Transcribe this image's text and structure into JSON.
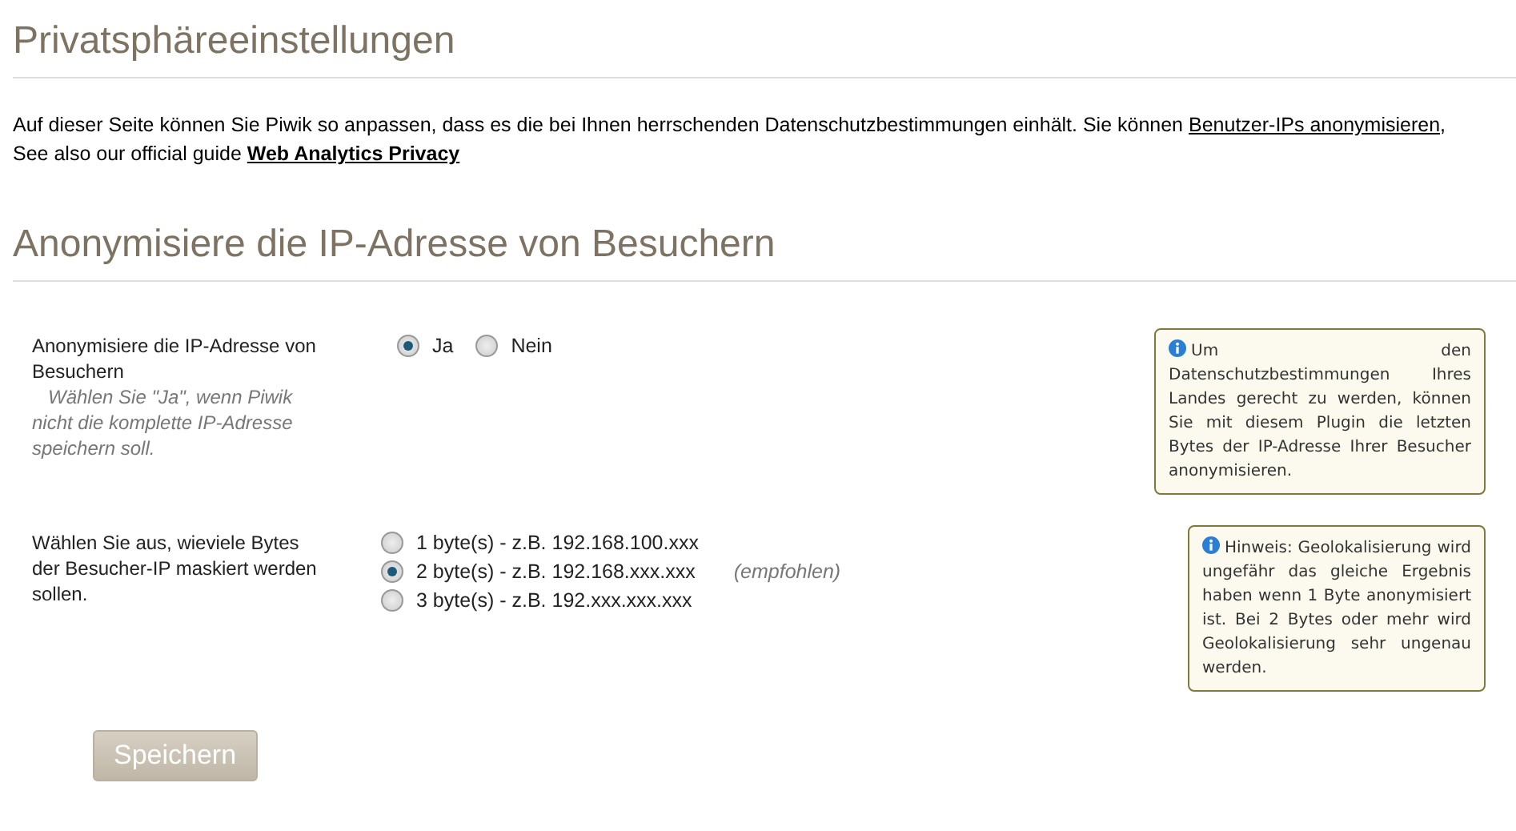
{
  "page_title": "Privatsphäreeinstellungen",
  "intro": {
    "text_before": "Auf dieser Seite können Sie Piwik so anpassen, dass es die bei Ihnen herrschenden Datenschutzbestimmungen einhält. Sie können ",
    "link_1": "Benutzer-IPs anonymisieren",
    "text_middle": ",",
    "text_line_2": "See also our official guide ",
    "link_2": "Web Analytics Privacy"
  },
  "section_title": "Anonymisiere die IP-Adresse von Besuchern",
  "settings": [
    {
      "label": "Anonymisiere die IP-Adresse von Besuchern",
      "description": "Wählen Sie \"Ja\", wenn Piwik nicht die komplette IP-Adresse speichern soll.",
      "kind": "inline",
      "options": [
        {
          "label": "Ja",
          "selected": true
        },
        {
          "label": "Nein",
          "selected": false
        }
      ],
      "help": "Um den Datenschutzbestimmungen Ihres Landes gerecht zu werden, können Sie mit diesem Plugin die letzten Bytes der IP-Adresse Ihrer Besucher anonymisieren."
    },
    {
      "label": "Wählen Sie aus, wieviele Bytes der Besucher-IP maskiert werden sollen.",
      "kind": "stacked",
      "options": [
        {
          "label": "1 byte(s) - z.B. 192.168.100.xxx",
          "selected": false
        },
        {
          "label": "2 byte(s) - z.B. 192.168.xxx.xxx",
          "selected": true,
          "note": "(empfohlen)"
        },
        {
          "label": "3 byte(s) - z.B. 192.xxx.xxx.xxx",
          "selected": false
        }
      ],
      "help": "Hinweis: Geolokalisierung wird ungefähr das gleiche Ergebnis haben wenn 1 Byte anonymisiert ist. Bei 2 Bytes oder mehr wird Geolokalisierung sehr ungenau werden."
    }
  ],
  "save_button": "Speichern"
}
